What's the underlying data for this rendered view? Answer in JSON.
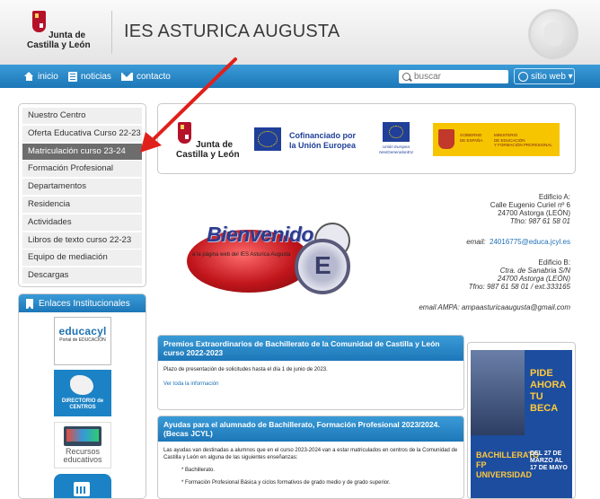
{
  "header": {
    "logo_line1": "Junta de",
    "logo_line2": "Castilla y León",
    "site_title": "IES ASTURICA AUGUSTA"
  },
  "nav": {
    "inicio": "inicio",
    "noticias": "noticias",
    "contacto": "contacto",
    "search_placeholder": "buscar",
    "sitio_web": "sitio web ▾"
  },
  "sidebar": {
    "items": [
      {
        "label": "Nuestro Centro"
      },
      {
        "label": "Oferta Educativa Curso 22-23"
      },
      {
        "label": "Matriculación curso 23-24"
      },
      {
        "label": "Formación Profesional"
      },
      {
        "label": "Departamentos"
      },
      {
        "label": "Residencia"
      },
      {
        "label": "Actividades"
      },
      {
        "label": "Libros de texto curso 22-23"
      },
      {
        "label": "Equipo de mediación"
      },
      {
        "label": "Descargas"
      }
    ],
    "active_index": 2
  },
  "enlaces": {
    "title": "Enlaces Institucionales",
    "educacyl_logo": "educacyl",
    "educacyl_sub": "Portal de EDUCACIÓN",
    "directorio": "DIRECTORIO de CENTROS",
    "recursos": "Recursos educativos"
  },
  "sponsors": {
    "jcyl_line1": "Junta de",
    "jcyl_line2": "Castilla y León",
    "ue_line1": "Cofinanciado por",
    "ue_line2": "la Unión Europea",
    "nextgen_line1": "Unión Europea",
    "nextgen_line2": "NextGenerationEU",
    "ministerio_left_1": "GOBIERNO",
    "ministerio_left_2": "DE ESPAÑA",
    "ministerio_right_1": "MINISTERIO",
    "ministerio_right_2": "DE EDUCACIÓN",
    "ministerio_right_3": "Y FORMACIÓN PROFESIONAL"
  },
  "welcome": {
    "bienvenido": "Bienvenido",
    "bienvenido_sub": "a la página web del IES Asturica Augusta",
    "edificio_a_title": "Edificio A:",
    "edificio_a_addr1": "Calle Eugenio Curiel nº 6",
    "edificio_a_addr2": "24700 Astorga (LEÓN)",
    "edificio_a_phone": "Tfno: 987 61 58 01",
    "email_label": "email:",
    "email": "24016775@educa.jcyl.es",
    "edificio_b_title": "Edificio B:",
    "edificio_b_addr1": "Ctra. de Sanabria S/N",
    "edificio_b_addr2": "24700 Astorga (LEÓN)",
    "edificio_b_phone": "Tfno: 987 61 58 01 / ext.333165",
    "ampa": "email AMPA: ampaasturicaaugusta@gmail.com"
  },
  "news": [
    {
      "title": "Premios Extraordinarios de Bachillerato de la Comunidad de Castilla y León curso  2022-2023",
      "body": "Plazo de presentación de solicitudes hasta el día 1 de junio de 2023.",
      "link": "Ver toda la información"
    },
    {
      "title": "Ayudas para el alumnado de Bachillerato, Formación Profesional 2023/2024. (Becas JCYL)",
      "body": "Las ayudas van destinadas a alumnos que en el curso 2023-2024 van a estar matriculados en centros de la Comunidad de Castilla y León en alguna de las siguientes enseñanzas:",
      "bullet1": "* Bachillerato.",
      "bullet2": "* Formación Profesional Básica y  ciclos formativos de grado medio y de grado superior."
    }
  ],
  "ad": {
    "headline": "PIDE AHORA TU BECA",
    "levels": "BACHILLERATO FP UNIVERSIDAD",
    "dates": "DEL 27 DE MARZO AL 17 DE MAYO"
  },
  "colors": {
    "nav_blue": "#2a86c6",
    "active_menu": "#6d6d6d",
    "arrow_red": "#e0201b"
  }
}
